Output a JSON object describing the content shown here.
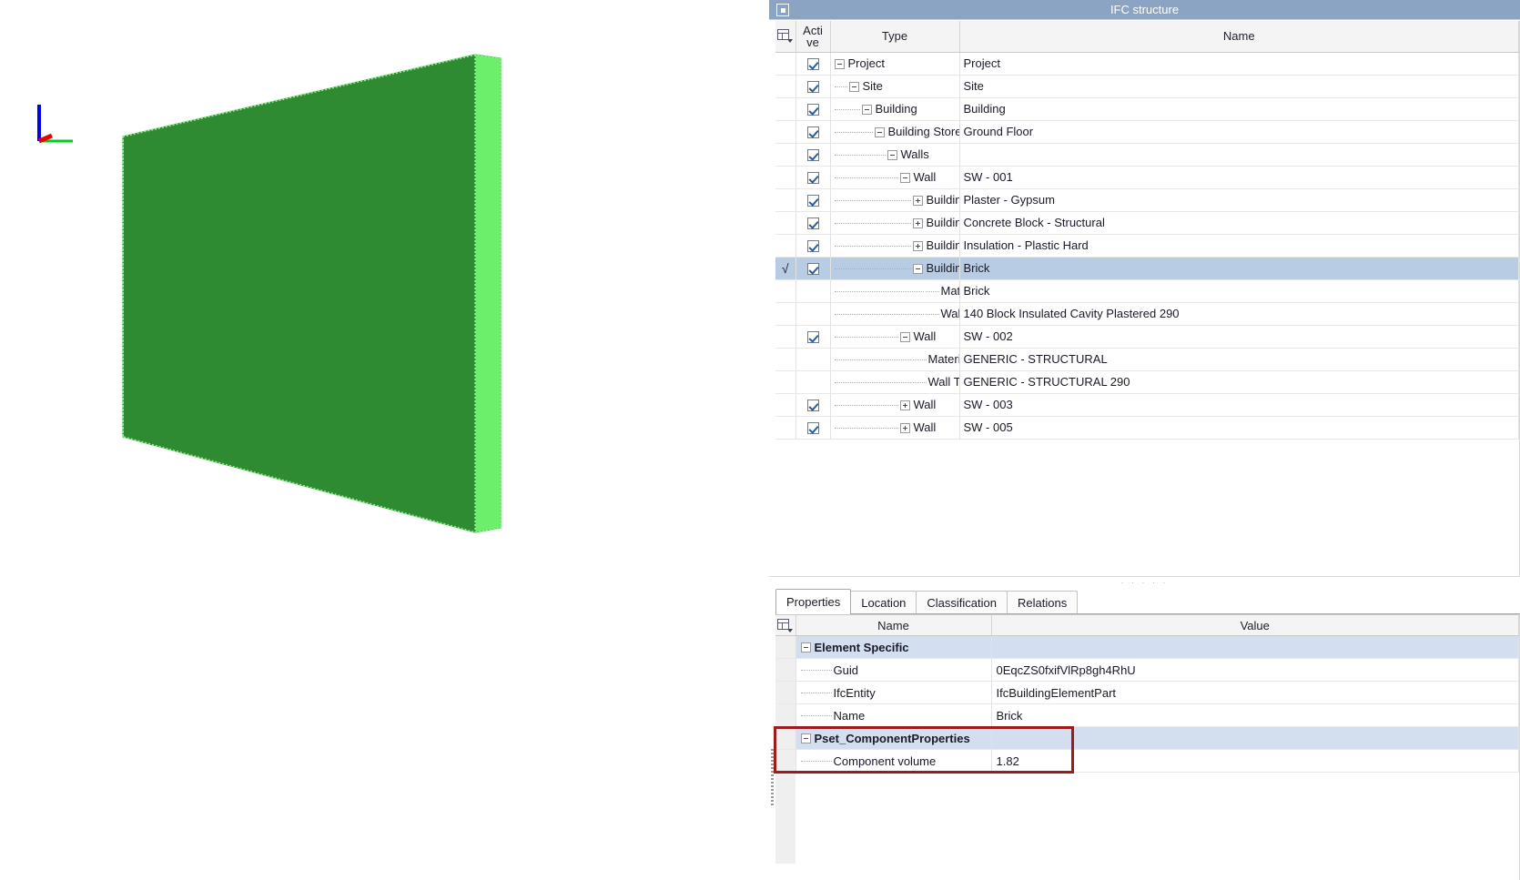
{
  "viewport": {
    "name": "3d-model-viewport",
    "axis_gizmo": {
      "z_axis_color": "#0000ee",
      "y_axis_color": "#00cc22",
      "x_axis_color": "#ee0000"
    },
    "model": {
      "label": "wall-slab",
      "face_color": "#2e8b31",
      "edge_color": "#66e066",
      "highlight_color": "#6cf06c"
    }
  },
  "ifc_panel": {
    "title": "IFC structure",
    "restore_button_label": "",
    "columns": {
      "select_icon": "grid-settings-icon",
      "active": "Acti\nve",
      "active_line1": "Acti",
      "active_line2": "ve",
      "type": "Type",
      "name": "Name"
    },
    "rows": [
      {
        "selected": false,
        "marked": false,
        "active": true,
        "indent": 0,
        "expander": "minus",
        "type": "Project",
        "name": "Project"
      },
      {
        "selected": false,
        "marked": false,
        "active": true,
        "indent": 1,
        "expander": "minus",
        "type": "Site",
        "name": "Site"
      },
      {
        "selected": false,
        "marked": false,
        "active": true,
        "indent": 2,
        "expander": "minus",
        "type": "Building",
        "name": "Building"
      },
      {
        "selected": false,
        "marked": false,
        "active": true,
        "indent": 3,
        "expander": "minus",
        "type": "Building Storey",
        "name": "Ground Floor"
      },
      {
        "selected": false,
        "marked": false,
        "active": true,
        "indent": 4,
        "expander": "minus",
        "type": "Walls",
        "name": ""
      },
      {
        "selected": false,
        "marked": false,
        "active": true,
        "indent": 5,
        "expander": "minus",
        "type": "Wall",
        "name": "SW - 001"
      },
      {
        "selected": false,
        "marked": false,
        "active": true,
        "indent": 6,
        "expander": "plus",
        "type": "Buildin...",
        "name": "Plaster - Gypsum"
      },
      {
        "selected": false,
        "marked": false,
        "active": true,
        "indent": 6,
        "expander": "plus",
        "type": "Buildin...",
        "name": "Concrete Block - Structural"
      },
      {
        "selected": false,
        "marked": false,
        "active": true,
        "indent": 6,
        "expander": "plus",
        "type": "Buildin...",
        "name": "Insulation - Plastic Hard"
      },
      {
        "selected": true,
        "marked": true,
        "active": true,
        "indent": 6,
        "expander": "minus",
        "type": "Buildin...",
        "name": "Brick"
      },
      {
        "selected": false,
        "marked": false,
        "active": false,
        "indent": 7,
        "expander": "none",
        "type": "Mat...",
        "name": "Brick"
      },
      {
        "selected": false,
        "marked": false,
        "active": false,
        "indent": 7,
        "expander": "none",
        "type": "Wall T...",
        "name": "140 Block Insulated Cavity Plastered 290"
      },
      {
        "selected": false,
        "marked": false,
        "active": true,
        "indent": 5,
        "expander": "minus",
        "type": "Wall",
        "name": "SW - 002"
      },
      {
        "selected": false,
        "marked": false,
        "active": false,
        "indent": 6,
        "expander": "none",
        "type": "Materi...",
        "name": "GENERIC - STRUCTURAL"
      },
      {
        "selected": false,
        "marked": false,
        "active": false,
        "indent": 6,
        "expander": "none",
        "type": "Wall T...",
        "name": "GENERIC - STRUCTURAL 290"
      },
      {
        "selected": false,
        "marked": false,
        "active": true,
        "indent": 5,
        "expander": "plus",
        "type": "Wall",
        "name": "SW - 003"
      },
      {
        "selected": false,
        "marked": false,
        "active": true,
        "indent": 5,
        "expander": "plus",
        "type": "Wall",
        "name": "SW - 005"
      }
    ]
  },
  "properties_panel": {
    "tabs": [
      {
        "label": "Properties",
        "active": true
      },
      {
        "label": "Location",
        "active": false
      },
      {
        "label": "Classification",
        "active": false
      },
      {
        "label": "Relations",
        "active": false
      }
    ],
    "columns": {
      "select_icon": "grid-settings-icon",
      "name": "Name",
      "value": "Value"
    },
    "rows": [
      {
        "kind": "group",
        "expander": "minus",
        "name": "Element Specific",
        "value": ""
      },
      {
        "kind": "item",
        "expander": "none",
        "name": "Guid",
        "value": "0EqcZS0fxifVlRp8gh4RhU"
      },
      {
        "kind": "item",
        "expander": "none",
        "name": "IfcEntity",
        "value": "IfcBuildingElementPart"
      },
      {
        "kind": "item",
        "expander": "none",
        "name": "Name",
        "value": "Brick"
      },
      {
        "kind": "group",
        "expander": "minus",
        "name": "Pset_ComponentProperties",
        "value": ""
      },
      {
        "kind": "item",
        "expander": "none",
        "name": "Component volume",
        "value": "1.82"
      }
    ],
    "highlight": {
      "name": "component-properties-highlight",
      "color": "#9e1b1b"
    }
  }
}
